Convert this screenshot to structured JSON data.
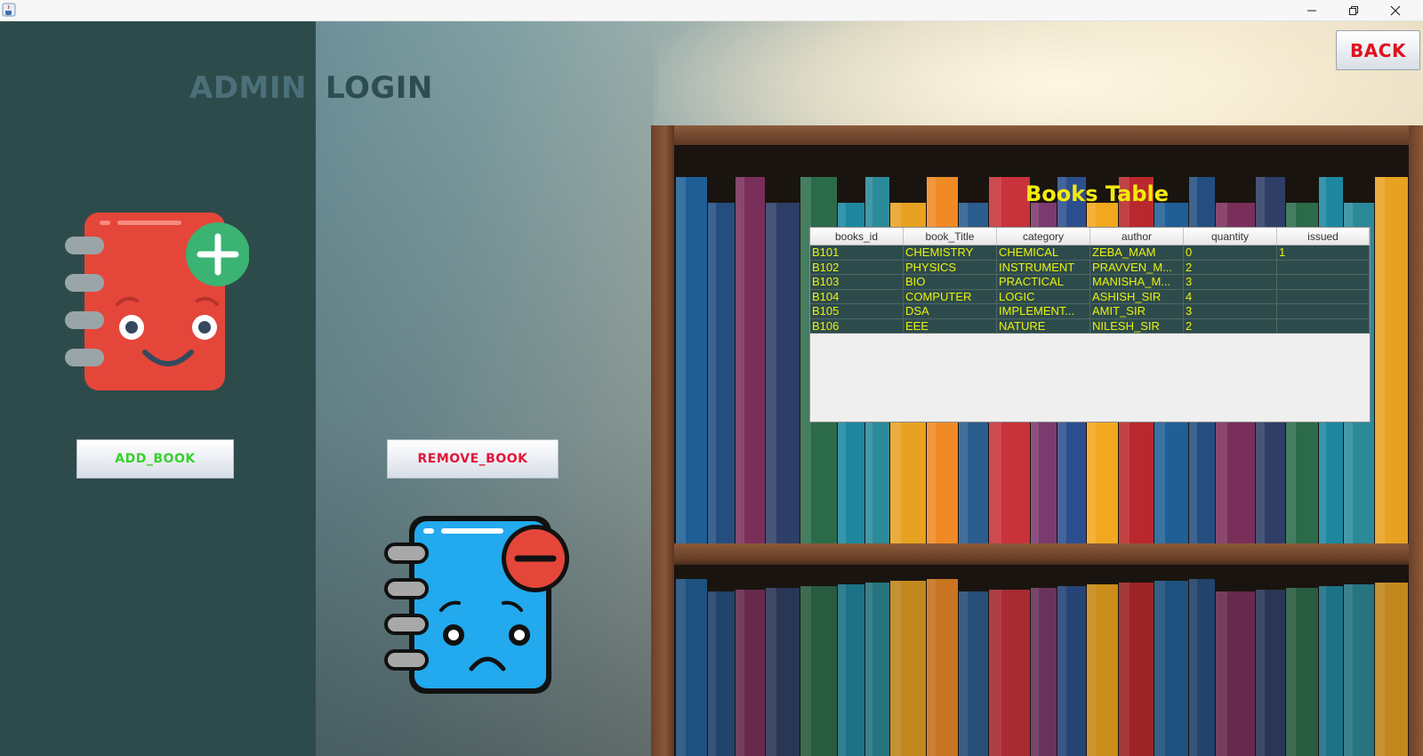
{
  "window": {
    "icons": {
      "app": "java-cup-icon",
      "minimize": "minimize-icon",
      "maximize": "restore-icon",
      "close": "close-icon"
    }
  },
  "header": {
    "title_word1": "ADMIN",
    "title_word2": "LOGIN"
  },
  "buttons": {
    "add_book": "ADD_BOOK",
    "remove_book": "REMOVE_BOOK",
    "back": "BACK"
  },
  "illustrations": {
    "add": "notebook-plus-icon",
    "remove": "notebook-minus-icon"
  },
  "books_table": {
    "title": "Books Table",
    "columns": [
      "books_id",
      "book_Title",
      "category",
      "author",
      "quantity",
      "issued"
    ],
    "rows": [
      [
        "B101",
        "CHEMISTRY",
        "CHEMICAL",
        "ZEBA_MAM",
        "0",
        "1"
      ],
      [
        "B102",
        "PHYSICS",
        "INSTRUMENT",
        "PRAVVEN_M...",
        "2",
        ""
      ],
      [
        "B103",
        "BIO",
        "PRACTICAL",
        "MANISHA_M...",
        "3",
        ""
      ],
      [
        "B104",
        "COMPUTER",
        "LOGIC",
        "ASHISH_SIR",
        "4",
        ""
      ],
      [
        "B105",
        "DSA",
        "IMPLEMENT...",
        "AMIT_SIR",
        "3",
        ""
      ],
      [
        "B106",
        "EEE",
        "NATURE",
        "NILESH_SIR",
        "2",
        ""
      ]
    ]
  },
  "colors": {
    "panel": "#2e4b4b",
    "table_text": "#e9f20e",
    "table_title": "#f4ea0c",
    "add_label": "#35d22a",
    "remove_label": "#e0163a",
    "back_label": "#e1101f"
  }
}
